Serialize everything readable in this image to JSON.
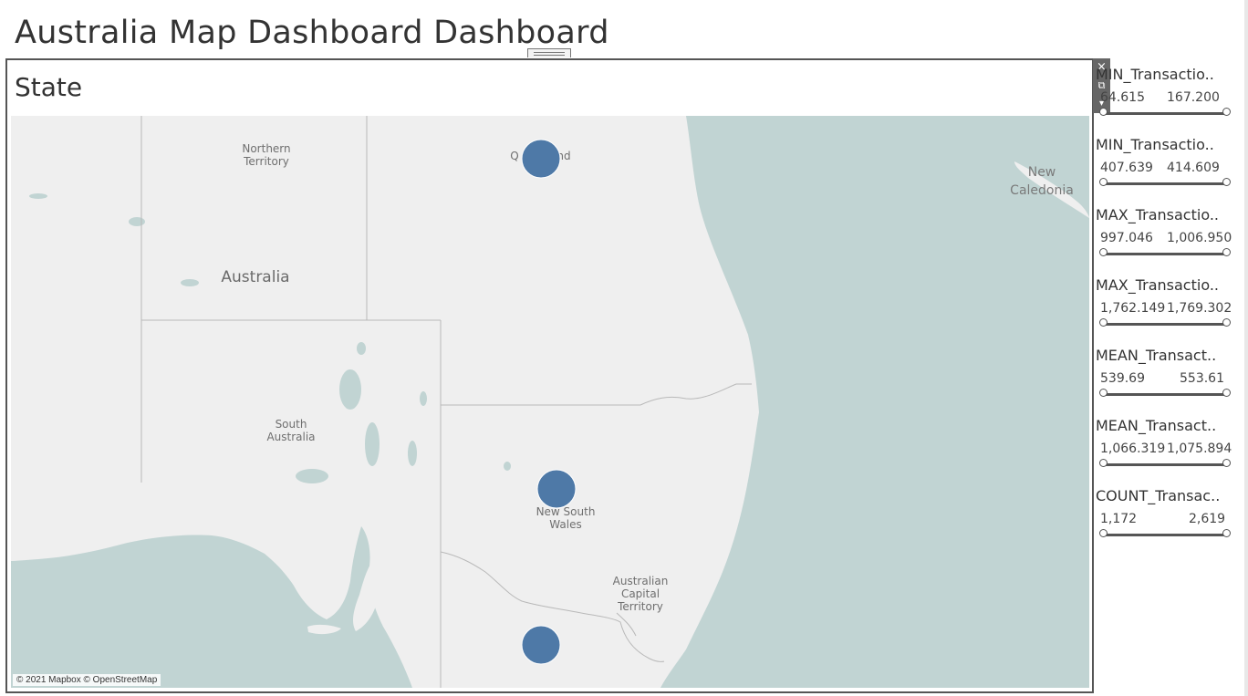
{
  "dashboard": {
    "title": "Australia Map Dashboard Dashboard"
  },
  "map": {
    "title": "State",
    "attribution": "© 2021 Mapbox © OpenStreetMap",
    "labels": {
      "northern_territory": [
        "Northern",
        "Territory"
      ],
      "australia": "Australia",
      "queensland_partial": [
        "Q",
        "nd"
      ],
      "south_australia": [
        "South",
        "Australia"
      ],
      "new_south_wales": [
        "New South",
        "Wales"
      ],
      "act": [
        "Australian",
        "Capital",
        "Territory"
      ],
      "new_caledonia": [
        "New",
        "Caledonia"
      ]
    },
    "markers": [
      {
        "state": "Queensland",
        "color": "#4e79a7"
      },
      {
        "state": "New South Wales",
        "color": "#4e79a7"
      },
      {
        "state": "Victoria",
        "color": "#4e79a7"
      }
    ],
    "colors": {
      "water": "#c1d4d3",
      "land": "#efefef",
      "border": "#bbbbbb",
      "marker": "#4e79a7"
    }
  },
  "toolbar": {
    "close_icon": "×",
    "popout_icon": "⧉",
    "menu_icon": "▾"
  },
  "filters": [
    {
      "title": "MIN_Transactio..",
      "min": "64.615",
      "max": "167.200"
    },
    {
      "title": "MIN_Transactio..",
      "min": "407.639",
      "max": "414.609"
    },
    {
      "title": "MAX_Transactio..",
      "min": "997.046",
      "max": "1,006.950"
    },
    {
      "title": "MAX_Transactio..",
      "min": "1,762.149",
      "max": "1,769.302"
    },
    {
      "title": "MEAN_Transact..",
      "min": "539.69",
      "max": "553.61"
    },
    {
      "title": "MEAN_Transact..",
      "min": "1,066.319",
      "max": "1,075.894"
    },
    {
      "title": "COUNT_Transac..",
      "min": "1,172",
      "max": "2,619"
    }
  ]
}
